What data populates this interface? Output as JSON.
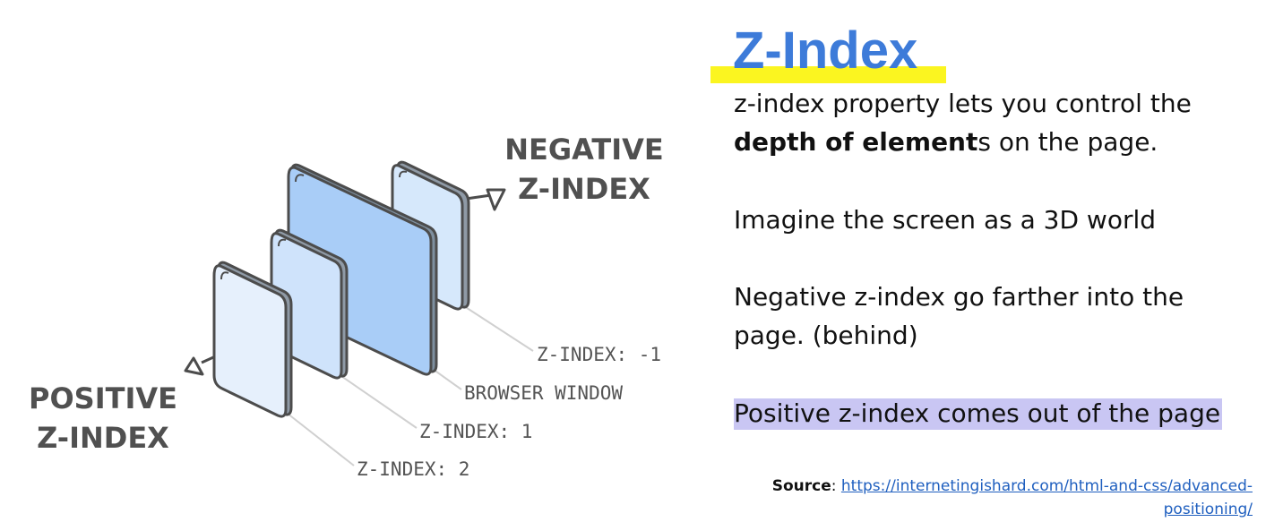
{
  "diagram": {
    "negative_label": [
      "NEGATIVE",
      "Z-INDEX"
    ],
    "positive_label": [
      "POSITIVE",
      "Z-INDEX"
    ],
    "layer_labels": {
      "minus_one": "Z-INDEX: -1",
      "browser": "BROWSER WINDOW",
      "one": "Z-INDEX: 1",
      "two": "Z-INDEX: 2"
    },
    "colors": {
      "browser_fill": "#a9cdf7",
      "layer1_fill": "#cfe3fb",
      "layer2_fill": "#e6f0fc",
      "back_fill": "#d6e8fb",
      "outline": "#4c4c4c"
    }
  },
  "slide": {
    "title": "Z-Index",
    "p1_text": "z-index property lets you control the",
    "p1_bold": "depth of element",
    "p1_rest": "s on the page.",
    "p2": "Imagine the screen as a 3D world",
    "p3_line1": "Negative z-index go farther into the",
    "p3_line2": "page. (behind)",
    "p4": "Positive z-index comes out of the page",
    "source_label": "Source",
    "source_sep": ": ",
    "source_link_line1": "https://internetingishard.com/html-and-css/advanced-",
    "source_link_line2": "positioning/"
  }
}
